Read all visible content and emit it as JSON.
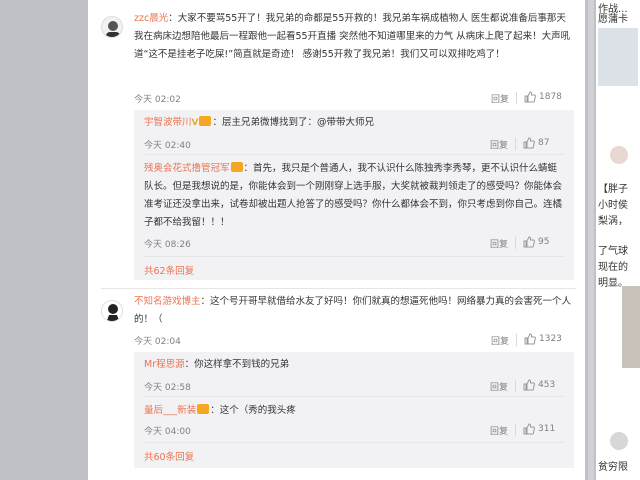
{
  "comments": [
    {
      "user": "zzc晨光",
      "text": "：大家不要骂55开了！我兄弟的命都是55开救的！我兄弟车祸成植物人 医生都说准备后事那天我在病床边想陪他最后一程跟他一起看55开直播 突然他不知道哪里来的力气 从病床上爬了起来！大声吼道“这不是挂老子吃屎!”简直就是奇迹！ 感谢55开救了我兄弟！我们又可以双排吃鸡了！",
      "time": "今天 02:02",
      "reply": "回复",
      "likes": "1878",
      "replies": [
        {
          "user": "宇智波带川",
          "text": "：层主兄弟微博找到了：@带带大师兄",
          "time": "今天 02:40",
          "reply": "回复",
          "likes": "87"
        },
        {
          "user": "残奥会花式撸管冠军",
          "text": "：首先，我只是个普通人，我不认识什么陈独秀李秀琴，更不认识什么蜻蜓队长。但是我想说的是，你能体会到一个刚刚穿上选手服，大奖就被裁判领走了的感受吗？你能体会准考证还没拿出来，试卷却被出题人抢答了的感受吗？你什么都体会不到，你只考虑到你自己。连橘子都不给我留！！！",
          "time": "今天 08:26",
          "reply": "回复",
          "likes": "95"
        }
      ],
      "more": "共62条回复"
    },
    {
      "user": "不知名游戏博主",
      "text": "：这个号开哥早就借给水友了好吗！你们就真的想逼死他吗！网络暴力真的会害死一个人的！（",
      "time": "今天 02:04",
      "reply": "回复",
      "likes": "1323",
      "replies": [
        {
          "user": "Mr程思源",
          "text": "：你这样拿不到钱的兄弟",
          "time": "今天 02:58",
          "reply": "回复",
          "likes": "453"
        },
        {
          "user": "量后___新装",
          "text": "：这个（秀的我头疼",
          "time": "今天 04:00",
          "reply": "回复",
          "likes": "311"
        }
      ],
      "more": "共60条回复"
    }
  ],
  "right_column": {
    "lines": [
      "作战...",
      "愿蒲卡",
      "【胖子",
      "小时侯",
      "梨涡，",
      "了气球",
      "现在的",
      "明显。",
      "贫穷限",
      "【"
    ]
  }
}
